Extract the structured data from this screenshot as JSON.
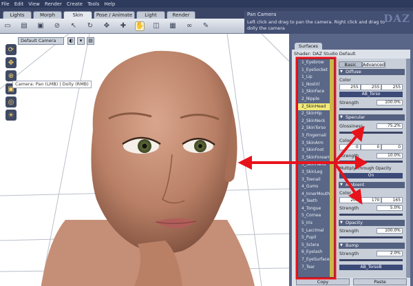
{
  "menubar": [
    "File",
    "Edit",
    "View",
    "Render",
    "Create",
    "Tools",
    "Help"
  ],
  "tabs": [
    "Lights",
    "Morph",
    "Skin",
    "Pose / Animate",
    "Light",
    "Render"
  ],
  "help": {
    "title": "Pan Camera",
    "text": "Left click and drag to pan the camera. Right click and drag to dolly the camera",
    "logo": "DAZ"
  },
  "viewport": {
    "camera": "Default Camera",
    "tooltip": "Camera: Pan (LMB) | Dolly (RMB)"
  },
  "panel": {
    "tab": "Surfaces",
    "shader": "Shader: DAZ Studio Default",
    "surfaces": [
      "1_Eyebrow",
      "1_EyeSocket",
      "1_Lip",
      "1_Nostril",
      "1_SkinFace",
      "2_Nipple",
      "2_SkinHead",
      "2_SkinHip",
      "2_SkinNeck",
      "2_SkinTorso",
      "3_Fingernail",
      "3_SkinArm",
      "3_SkinFoot",
      "3_SkinForearm",
      "3_SkinHand",
      "3_SkinLeg",
      "3_Toenail",
      "4_Gums",
      "4_InnerMouth",
      "4_Teeth",
      "4_Tongue",
      "5_Cornea",
      "5_Iris",
      "5_Lacrimal",
      "5_Pupil",
      "5_Sclera",
      "6_Eyelash",
      "7_EyeSurface",
      "7_Tear"
    ],
    "selected": "2_SkinHead",
    "prop_tabs": [
      "Basic",
      "Advanced"
    ],
    "diffuse": {
      "title": "Diffuse",
      "color_label": "Color",
      "rgb": [
        "255",
        "255",
        "255"
      ],
      "map": "AB_Torso",
      "strength_label": "Strength",
      "strength": "100.0%"
    },
    "specular": {
      "title": "Specular",
      "glossiness_label": "Glossiness",
      "glossiness": "75.2%",
      "color_label": "Color",
      "rgb": [
        "0",
        "0",
        "0"
      ],
      "strength_label": "Strength",
      "strength": "10.0%",
      "multiply_label": "Multiply Through Opacity",
      "multiply_value": "On"
    },
    "ambient": {
      "title": "Ambient",
      "color_label": "Color",
      "rgb": [
        "207",
        "170",
        "165"
      ],
      "strength_label": "Strength",
      "strength": "5.0%"
    },
    "opacity": {
      "title": "Opacity",
      "strength_label": "Strength",
      "strength": "100.0%"
    },
    "bump": {
      "title": "Bump",
      "strength_label": "Strength",
      "strength": "2.0%",
      "map": "AB_TorsoB"
    },
    "copy": "Copy",
    "paste": "Paste"
  }
}
